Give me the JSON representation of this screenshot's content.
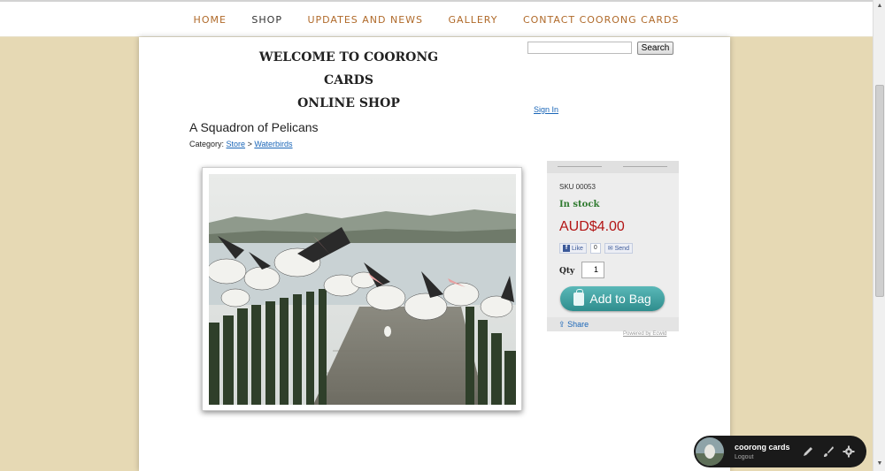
{
  "nav": {
    "items": [
      {
        "label": "HOME"
      },
      {
        "label": "SHOP"
      },
      {
        "label": "UPDATES AND NEWS"
      },
      {
        "label": "GALLERY"
      },
      {
        "label": "CONTACT COORONG CARDS"
      }
    ],
    "active": "SHOP"
  },
  "header": {
    "welcome_line1": "WELCOME TO COORONG CARDS",
    "welcome_line2": "ONLINE SHOP"
  },
  "search": {
    "value": "",
    "button_label": "Search"
  },
  "account": {
    "signin_label": "Sign In"
  },
  "product": {
    "title": "A Squadron of Pelicans",
    "category_prefix": "Category:",
    "category_root": "Store",
    "category_sep": ">",
    "category_leaf": "Waterbirds",
    "sku": "SKU 00053",
    "stock": "In stock",
    "price": "AUD$4.00",
    "like_label": "Like",
    "like_count": "0",
    "send_label": "Send",
    "qty_label": "Qty",
    "qty_value": "1",
    "add_to_bag_label": "Add to Bag",
    "share_label": "Share",
    "powered_by": "Powered by Ecwid"
  },
  "admin_bar": {
    "site_name": "coorong cards",
    "logout_label": "Logout"
  },
  "colors": {
    "background": "#e6d9b4",
    "nav_link": "#b06a2a",
    "price": "#b31515",
    "stock": "#2f7a2f",
    "link": "#1a66b8",
    "add_button": "#3a9a9a"
  },
  "icons": {
    "share": "share-icon",
    "bag": "bag-icon",
    "edit": "pencil-icon",
    "design": "brush-icon",
    "settings": "gear-icon"
  }
}
